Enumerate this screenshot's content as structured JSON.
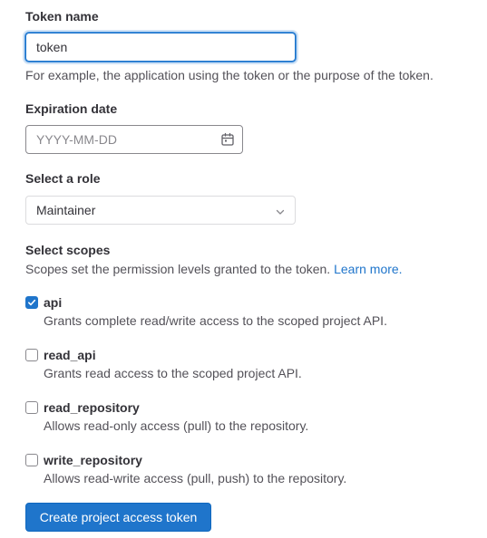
{
  "token_name": {
    "label": "Token name",
    "value": "token",
    "help": "For example, the application using the token or the purpose of the token."
  },
  "expiration": {
    "label": "Expiration date",
    "placeholder": "YYYY-MM-DD",
    "icon": "calendar-icon"
  },
  "role": {
    "label": "Select a role",
    "selected": "Maintainer",
    "icon": "chevron-down-icon"
  },
  "scopes": {
    "label": "Select scopes",
    "help": "Scopes set the permission levels granted to the token.",
    "learn_more": "Learn more.",
    "items": [
      {
        "name": "api",
        "description": "Grants complete read/write access to the scoped project API.",
        "checked": true
      },
      {
        "name": "read_api",
        "description": "Grants read access to the scoped project API.",
        "checked": false
      },
      {
        "name": "read_repository",
        "description": "Allows read-only access (pull) to the repository.",
        "checked": false
      },
      {
        "name": "write_repository",
        "description": "Allows read-write access (pull, push) to the repository.",
        "checked": false
      }
    ]
  },
  "submit": {
    "label": "Create project access token"
  },
  "colors": {
    "accent": "#1f75cb",
    "text": "#333238",
    "muted": "#535158",
    "border": "#dcdcde"
  }
}
